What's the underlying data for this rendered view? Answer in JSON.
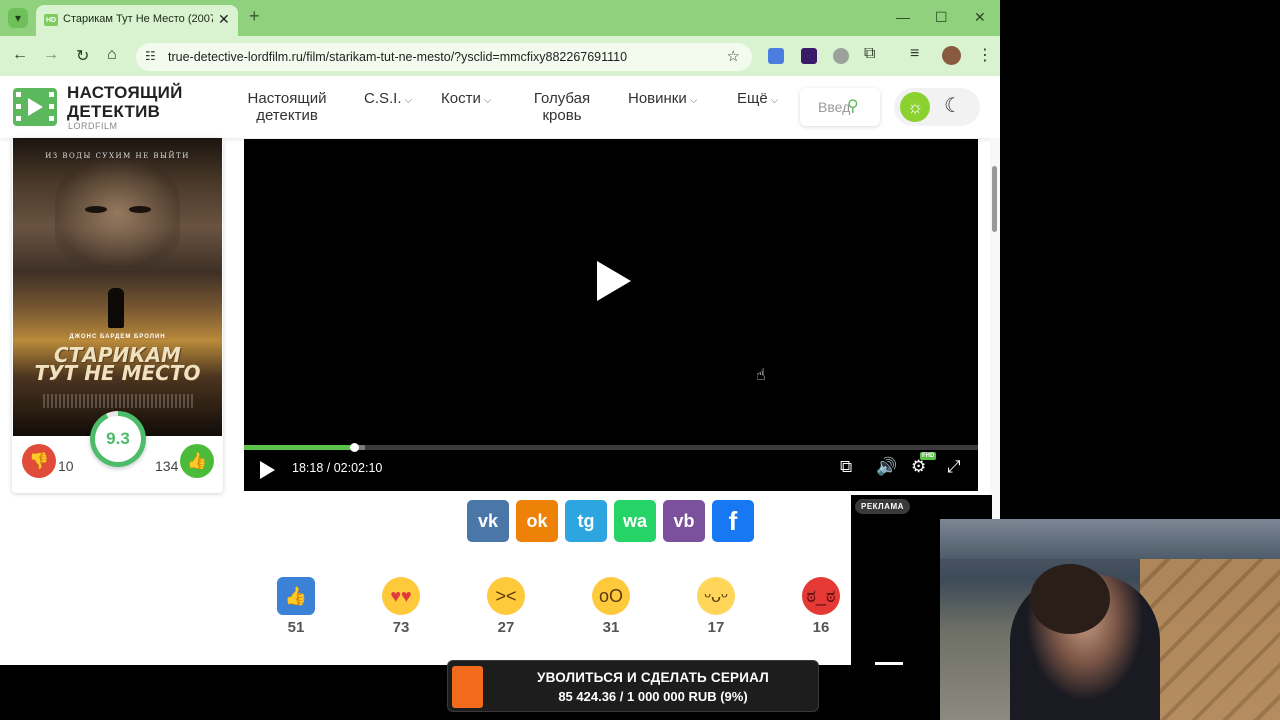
{
  "browser": {
    "tab_title": "Старикам Тут Не Место (2007)",
    "tab_favicon": "HD",
    "url": "true-detective-lordfilm.ru/film/starikam-tut-ne-mesto/?ysclid=mmcfixy882267691110",
    "accent": "#8fd17c"
  },
  "site": {
    "logo_title": "НАСТОЯЩИЙ ДЕТЕКТИВ",
    "logo_sub": "LORDFILM",
    "nav": [
      {
        "label": "Настоящий детектив"
      },
      {
        "label": "C.S.I."
      },
      {
        "label": "Кости"
      },
      {
        "label": "Голубая кровь"
      },
      {
        "label": "Новинки"
      },
      {
        "label": "Ещё"
      }
    ],
    "search_placeholder": "Введ"
  },
  "poster": {
    "tagline": "ИЗ ВОДЫ СУХИМ НЕ ВЫЙТИ",
    "actors": "ДЖОНС  БАРДЕМ  БРОЛИН",
    "title_line1": "СТАРИКАМ",
    "title_line2": "ТУТ НЕ МЕСТО",
    "rating": "9.3",
    "rating_fraction": 0.93,
    "dislikes": "10",
    "likes": "134"
  },
  "player": {
    "time": "18:18 / 02:02:10",
    "progress_fraction": 0.15,
    "buffer_fraction": 0.165,
    "quality_badge": "FHD"
  },
  "share": [
    {
      "name": "vk",
      "label": "vk",
      "color": "#4a76a8"
    },
    {
      "name": "ok",
      "label": "ok",
      "color": "#ee8208"
    },
    {
      "name": "telegram",
      "label": "tg",
      "color": "#2ca5e0"
    },
    {
      "name": "whatsapp",
      "label": "wa",
      "color": "#25d366"
    },
    {
      "name": "viber",
      "label": "vb",
      "color": "#7b519d"
    },
    {
      "name": "facebook",
      "label": "f",
      "color": "#1877f2"
    }
  ],
  "reactions": [
    {
      "icon": "thumbs-up-icon",
      "count": "51"
    },
    {
      "icon": "heart-eyes-icon",
      "count": "73"
    },
    {
      "icon": "laughing-icon",
      "count": "27"
    },
    {
      "icon": "surprised-icon",
      "count": "31"
    },
    {
      "icon": "sad-icon",
      "count": "17"
    },
    {
      "icon": "angry-icon",
      "count": "16"
    }
  ],
  "ad": {
    "label": "РЕКЛАМА"
  },
  "donation": {
    "title": "УВОЛИТЬСЯ И СДЕЛАТЬ СЕРИАЛ",
    "amount": "85 424.36 / 1 000 000 RUB (9%)",
    "progress_fraction": 0.09,
    "color": "#f26b1d"
  }
}
